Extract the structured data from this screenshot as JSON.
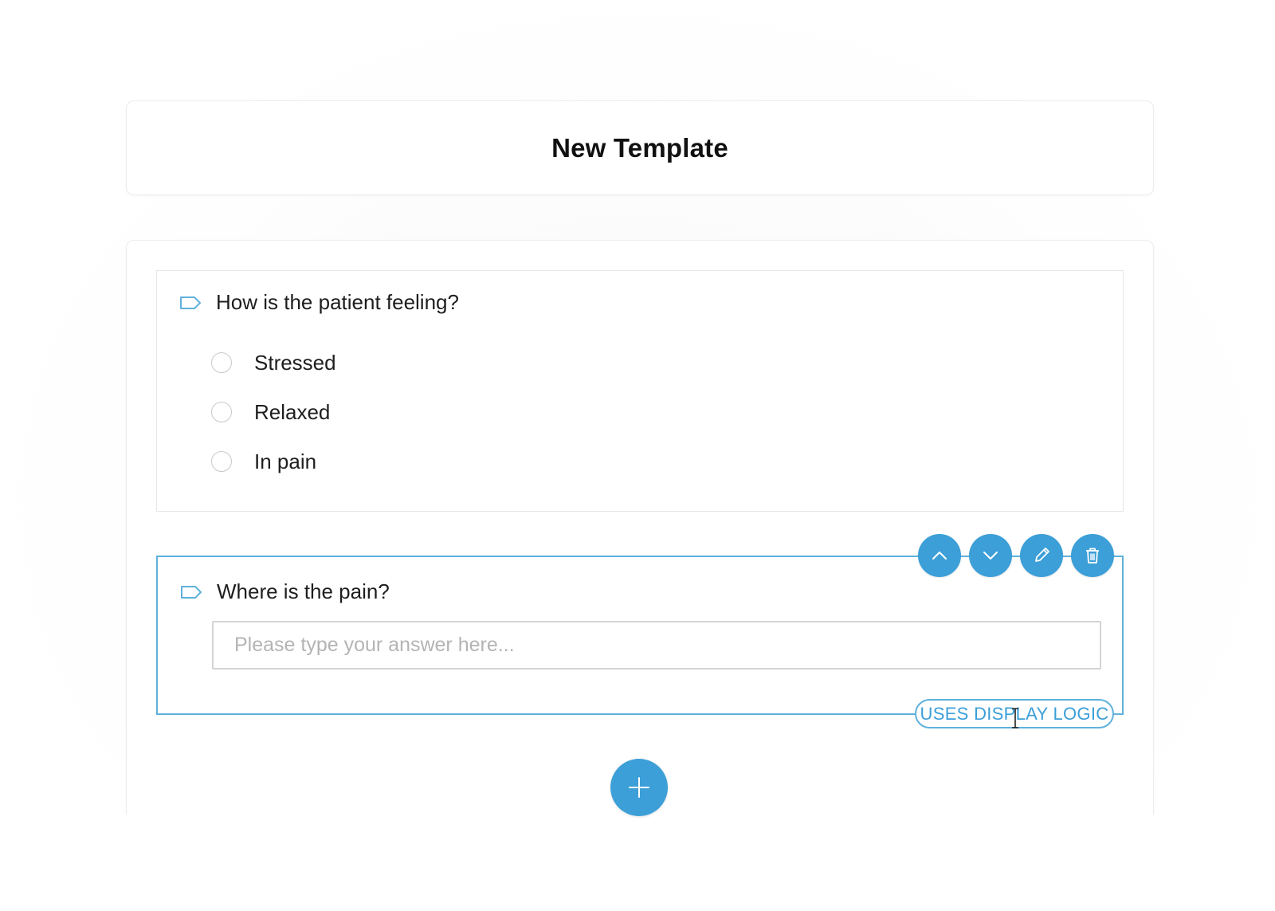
{
  "template": {
    "title": "New Template"
  },
  "questions": [
    {
      "text": "How is the patient feeling?",
      "type": "radio",
      "options": [
        {
          "label": "Stressed"
        },
        {
          "label": "Relaxed"
        },
        {
          "label": "In pain"
        }
      ]
    },
    {
      "text": "Where is the pain?",
      "type": "text",
      "value": "",
      "placeholder": "Please type your answer here...",
      "badge": "USES DISPLAY LOGIC",
      "actions": {
        "icons": [
          "chevron-up-icon",
          "chevron-down-icon",
          "pencil-icon",
          "trash-icon"
        ]
      }
    }
  ],
  "add_question": {
    "icon": "plus-icon"
  },
  "colors": {
    "accent": "#3c9fd8",
    "accent_border": "#5fb1dc",
    "card_border": "#e6e6e6",
    "placeholder": "#b4b4b4"
  }
}
